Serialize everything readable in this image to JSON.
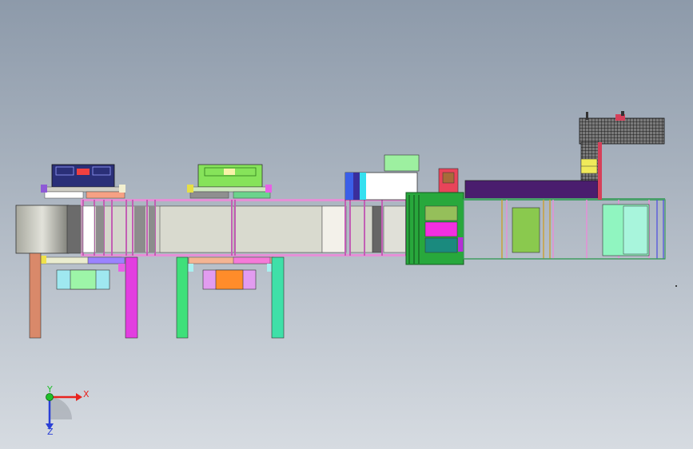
{
  "viewport": {
    "background_top": "#8d9aaa",
    "background_bottom": "#d6dbe1"
  },
  "triad": {
    "x_label": "X",
    "y_label": "Y",
    "z_label": "Z",
    "x_color": "#e8231e",
    "y_color": "#1fbf2a",
    "z_color": "#2a3fd6"
  },
  "colors": {
    "conveyor_body": "#d5d6cc",
    "roller_grey": "#b9b6b0",
    "frame_pink": "#e58fd6",
    "leg_orange": "#d9896a",
    "leg_magenta": "#e23ee0",
    "leg_green": "#3fe07a",
    "leg_teal": "#3fe0a8",
    "station1_head": "#2a2f78",
    "station2_head": "#86e35a",
    "cabinet_green": "#28a83c",
    "gantry_purple": "#4a1d6e",
    "mesh_black": "#222222"
  }
}
